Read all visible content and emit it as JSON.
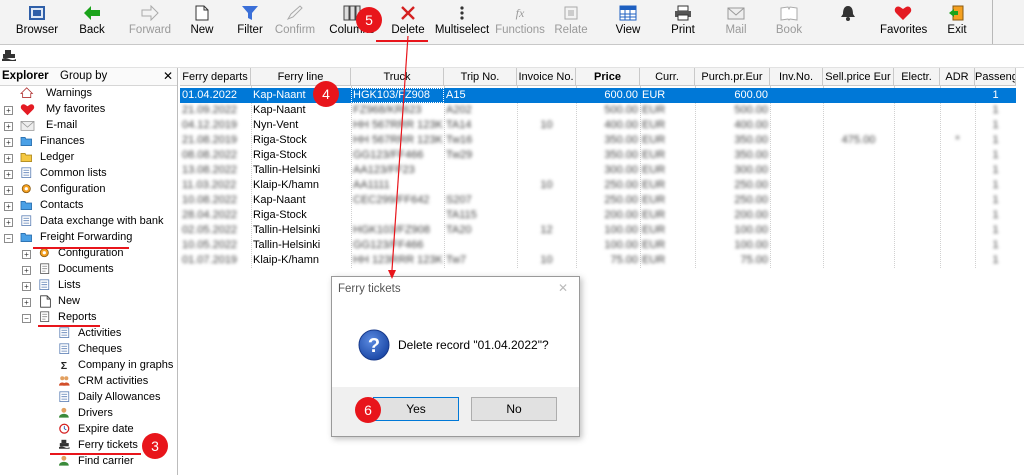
{
  "toolbar": {
    "buttons": [
      {
        "label": "Browser",
        "icon": "browser-icon",
        "enabled": true
      },
      {
        "label": "Back",
        "icon": "back-arrow-icon",
        "enabled": true
      },
      {
        "label": "Forward",
        "icon": "forward-arrow-icon",
        "enabled": false
      },
      {
        "label": "New",
        "icon": "new-document-icon",
        "enabled": true
      },
      {
        "label": "Filter",
        "icon": "filter-icon",
        "enabled": true
      },
      {
        "label": "Confirm",
        "icon": "confirm-icon",
        "enabled": false
      },
      {
        "label": "Columns",
        "icon": "columns-icon",
        "enabled": true
      },
      {
        "label": "Delete",
        "icon": "delete-x-icon",
        "enabled": true
      },
      {
        "label": "Multiselect",
        "icon": "multiselect-icon",
        "enabled": true
      },
      {
        "label": "Functions",
        "icon": "functions-icon",
        "enabled": false
      },
      {
        "label": "Relate",
        "icon": "relate-icon",
        "enabled": false
      },
      {
        "label": "View",
        "icon": "view-icon",
        "enabled": true
      },
      {
        "label": "Print",
        "icon": "printer-icon",
        "enabled": true
      },
      {
        "label": "Mail",
        "icon": "mail-icon",
        "enabled": false
      },
      {
        "label": "Book",
        "icon": "book-icon",
        "enabled": false
      },
      {
        "label": "",
        "icon": "bell-icon",
        "enabled": true
      },
      {
        "label": "Favorites",
        "icon": "heart-icon",
        "enabled": true
      },
      {
        "label": "Exit",
        "icon": "exit-door-icon",
        "enabled": true
      }
    ]
  },
  "explorer": {
    "tabs": [
      "Explorer",
      "Group by"
    ],
    "close_glyph": "✕",
    "items": [
      {
        "label": "Warnings",
        "icon": "house-icon",
        "level": 1,
        "expander": ""
      },
      {
        "label": "My favorites",
        "icon": "heart-icon",
        "level": 1,
        "expander": "+"
      },
      {
        "label": "E-mail",
        "icon": "mail-icon",
        "level": 1,
        "expander": "+"
      },
      {
        "label": "Finances",
        "icon": "folder-icon",
        "level": 1,
        "expander": "+"
      },
      {
        "label": "Ledger",
        "icon": "folder-icon",
        "level": 1,
        "expander": "+"
      },
      {
        "label": "Common lists",
        "icon": "list-icon",
        "level": 1,
        "expander": "+"
      },
      {
        "label": "Configuration",
        "icon": "gear-icon",
        "level": 1,
        "expander": "+"
      },
      {
        "label": "Contacts",
        "icon": "folder-icon",
        "level": 1,
        "expander": "+"
      },
      {
        "label": "Data exchange with bank",
        "icon": "list-icon",
        "level": 1,
        "expander": "+"
      },
      {
        "label": "Freight Forwarding",
        "icon": "folder-icon",
        "level": 1,
        "expander": "−"
      },
      {
        "label": "Configuration",
        "icon": "gear-icon",
        "level": 2,
        "expander": "+"
      },
      {
        "label": "Documents",
        "icon": "document-icon",
        "level": 2,
        "expander": "+"
      },
      {
        "label": "Lists",
        "icon": "list-icon",
        "level": 2,
        "expander": "+"
      },
      {
        "label": "New",
        "icon": "new-document-icon",
        "level": 2,
        "expander": "+"
      },
      {
        "label": "Reports",
        "icon": "document-icon",
        "level": 2,
        "expander": "−"
      },
      {
        "label": "Activities",
        "icon": "list-icon",
        "level": 3,
        "expander": ""
      },
      {
        "label": "Cheques",
        "icon": "list-icon",
        "level": 3,
        "expander": ""
      },
      {
        "label": "Company in graphs",
        "icon": "sigma-icon",
        "level": 3,
        "expander": ""
      },
      {
        "label": "CRM activities",
        "icon": "people-icon",
        "level": 3,
        "expander": ""
      },
      {
        "label": "Daily Allowances",
        "icon": "list-icon",
        "level": 3,
        "expander": ""
      },
      {
        "label": "Drivers",
        "icon": "person-icon",
        "level": 3,
        "expander": ""
      },
      {
        "label": "Expire date",
        "icon": "clock-icon",
        "level": 3,
        "expander": ""
      },
      {
        "label": "Ferry tickets",
        "icon": "ferry-icon",
        "level": 3,
        "expander": ""
      },
      {
        "label": "Find carrier",
        "icon": "person-icon",
        "level": 3,
        "expander": ""
      }
    ]
  },
  "grid": {
    "columns": [
      "Ferry departs",
      "Ferry line",
      "Truck",
      "Trip No.",
      "Invoice No.",
      "Price",
      "Curr.",
      "Purch.pr.Eur",
      "Inv.No.",
      "Sell.price Eur",
      "Electr.",
      "ADR",
      "Passeng"
    ],
    "rows": [
      {
        "date": "01.04.2022",
        "line": "Kap-Naant",
        "truck": "HGK103/FZ908",
        "trip": "A15",
        "inv": "",
        "price": "600.00",
        "curr": "EUR",
        "purch": "600.00",
        "invno": "",
        "sell": "",
        "electr": "",
        "adr": "",
        "pass": "1",
        "selected": true
      },
      {
        "date": "21.09.2022",
        "line": "Kap-Naant",
        "truck": "FZ968/KR623",
        "trip": "A202",
        "inv": "",
        "price": "500.00",
        "curr": "EUR",
        "purch": "500.00",
        "invno": "",
        "sell": "",
        "electr": "",
        "adr": "",
        "pass": "1",
        "selected": false
      },
      {
        "date": "04.12.2019",
        "line": "Nyn-Vent",
        "truck": "HH 567RRR 123K",
        "trip": "TA14",
        "inv": "10",
        "price": "400.00",
        "curr": "EUR",
        "purch": "400.00",
        "invno": "",
        "sell": "",
        "electr": "",
        "adr": "",
        "pass": "1",
        "selected": false
      },
      {
        "date": "21.08.2019",
        "line": "Riga-Stock",
        "truck": "HH 567RRR 123K",
        "trip": "Tw16",
        "inv": "",
        "price": "350.00",
        "curr": "EUR",
        "purch": "350.00",
        "invno": "",
        "sell": "475.00",
        "electr": "",
        "adr": "*",
        "pass": "1",
        "selected": false
      },
      {
        "date": "08.08.2022",
        "line": "Riga-Stock",
        "truck": "GG123/FF466",
        "trip": "Tw29",
        "inv": "",
        "price": "350.00",
        "curr": "EUR",
        "purch": "350.00",
        "invno": "",
        "sell": "",
        "electr": "",
        "adr": "",
        "pass": "1",
        "selected": false
      },
      {
        "date": "13.08.2022",
        "line": "Tallin-Helsinki",
        "truck": "AA123/FF23",
        "trip": "",
        "inv": "",
        "price": "300.00",
        "curr": "EUR",
        "purch": "300.00",
        "invno": "",
        "sell": "",
        "electr": "",
        "adr": "",
        "pass": "1",
        "selected": false
      },
      {
        "date": "11.03.2022",
        "line": "Klaip-K/hamn",
        "truck": "AA1111",
        "trip": "",
        "inv": "10",
        "price": "250.00",
        "curr": "EUR",
        "purch": "250.00",
        "invno": "",
        "sell": "",
        "electr": "",
        "adr": "",
        "pass": "1",
        "selected": false
      },
      {
        "date": "10.08.2022",
        "line": "Kap-Naant",
        "truck": "CEC299/FF642",
        "trip": "S207",
        "inv": "",
        "price": "250.00",
        "curr": "EUR",
        "purch": "250.00",
        "invno": "",
        "sell": "",
        "electr": "",
        "adr": "",
        "pass": "1",
        "selected": false
      },
      {
        "date": "28.04.2022",
        "line": "Riga-Stock",
        "truck": "",
        "trip": "TA115",
        "inv": "",
        "price": "200.00",
        "curr": "EUR",
        "purch": "200.00",
        "invno": "",
        "sell": "",
        "electr": "",
        "adr": "",
        "pass": "1",
        "selected": false
      },
      {
        "date": "02.05.2022",
        "line": "Tallin-Helsinki",
        "truck": "HGK103/FZ908",
        "trip": "TA20",
        "inv": "12",
        "price": "100.00",
        "curr": "EUR",
        "purch": "100.00",
        "invno": "",
        "sell": "",
        "electr": "",
        "adr": "",
        "pass": "1",
        "selected": false
      },
      {
        "date": "10.05.2022",
        "line": "Tallin-Helsinki",
        "truck": "GG123/FF466",
        "trip": "",
        "inv": "",
        "price": "100.00",
        "curr": "EUR",
        "purch": "100.00",
        "invno": "",
        "sell": "",
        "electr": "",
        "adr": "",
        "pass": "1",
        "selected": false
      },
      {
        "date": "01.07.2019",
        "line": "Klaip-K/hamn",
        "truck": "HH 123RRR 123K",
        "trip": "Tw7",
        "inv": "10",
        "price": "75.00",
        "curr": "EUR",
        "purch": "75.00",
        "invno": "",
        "sell": "",
        "electr": "",
        "adr": "",
        "pass": "1",
        "selected": false
      }
    ]
  },
  "dialog": {
    "title": "Ferry tickets",
    "close_glyph": "✕",
    "icon": "question-icon",
    "message": "Delete record \"01.04.2022\"?",
    "yes_label": "Yes",
    "no_label": "No"
  },
  "callouts": [
    "3",
    "4",
    "5",
    "6"
  ],
  "colors": {
    "selection": "#0078d7",
    "callout": "#e8151b",
    "back_green": "#1aa31a",
    "delete_red": "#d42020",
    "filter_blue": "#3a6fd8",
    "folder_yellow": "#f5c842",
    "folder_blue": "#4aa0e6"
  }
}
